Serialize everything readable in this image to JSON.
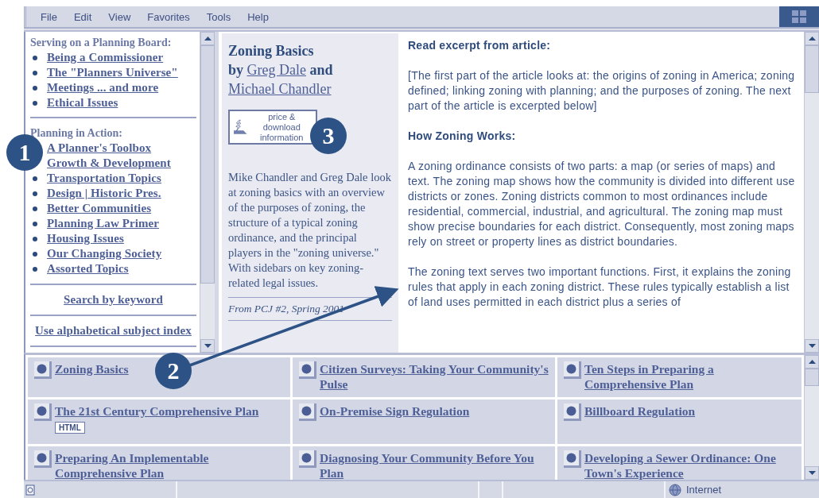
{
  "menu_bar": {
    "items": [
      "File",
      "Edit",
      "View",
      "Favorites",
      "Tools",
      "Help"
    ]
  },
  "nav": {
    "sections": [
      {
        "heading": "Serving on a Planning Board:",
        "links": [
          {
            "label": "Being a Commissioner",
            "bullet": true
          },
          {
            "label": "The \"Planners Universe\"",
            "bullet": true
          },
          {
            "label": "Meetings ... and more",
            "bullet": true
          },
          {
            "label": "Ethical Issues",
            "bullet": true
          }
        ]
      },
      {
        "heading": "Planning in Action:",
        "links": [
          {
            "label": "A Planner's Toolbox",
            "bullet": false
          },
          {
            "label": "Growth & Development",
            "bullet": false
          },
          {
            "label": "Transportation Topics",
            "bullet": true
          },
          {
            "label": "Design | Historic Pres.",
            "bullet": true
          },
          {
            "label": "Better Communities",
            "bullet": true
          },
          {
            "label": "Planning Law Primer",
            "bullet": true
          },
          {
            "label": "Housing Issues",
            "bullet": true
          },
          {
            "label": "Our Changing Society",
            "bullet": true
          },
          {
            "label": "Assorted Topics",
            "bullet": true
          }
        ]
      }
    ],
    "footer_links": [
      "Search by keyword",
      "Use alphabetical subject index"
    ]
  },
  "article": {
    "title": "Zoning Basics",
    "byline_prefix": "by",
    "authors": [
      "Greg Dale",
      "Michael Chandler"
    ],
    "joiner": "and",
    "button_label": "price & download information",
    "summary": "Mike Chandler and Greg Dale look at zoning basics with an overview of the purposes of zoning, the structure of a typical zoning ordinance, and the principal players in the \"zoning universe.\" With sidebars on key zoning-related legal issues.",
    "source": "From PCJ #2, Spring 2001"
  },
  "excerpt": {
    "heading": "Read excerpt from article:",
    "intro": "[The first part of the article looks at: the origins of zoning in America; zoning defined; linking zoning with planning; and the purposes of zoning. The next part of the article is excerpted below]",
    "subheading": "How Zoning Works:",
    "paragraphs": [
      "A zoning ordinance consists of two parts: a map (or series of maps) and text. The zoning map shows how the community is divided into different use districts or zones. Zoning districts common to most ordinances include residential, commercial, industrial, and agricultural. The zoning map must show precise boundaries for each district. Consequently, most zoning maps rely on street or property lines as district boundaries.",
      "The zoning text serves two important functions. First, it explains the zoning rules that apply in each zoning district. These rules typically establish a list of land uses permitted in each district plus a series of"
    ]
  },
  "resources": {
    "rows": [
      [
        {
          "label": "Zoning Basics"
        },
        {
          "label": "Citizen Surveys: Taking Your Community's Pulse"
        },
        {
          "label": "Ten Steps in Preparing a Comprehensive Plan"
        }
      ],
      [
        {
          "label": "The 21st Century Comprehensive Plan",
          "badge": "HTML"
        },
        {
          "label": "On-Premise Sign Regulation"
        },
        {
          "label": "Billboard Regulation"
        }
      ],
      [
        {
          "label": "Preparing An Implementable Comprehensive Plan"
        },
        {
          "label": "Diagnosing Your Community Before You Plan"
        },
        {
          "label": "Developing a Sewer Ordinance: One Town's Experience"
        }
      ]
    ]
  },
  "status_bar": {
    "zone": "Internet"
  },
  "callouts": [
    {
      "number": "1"
    },
    {
      "number": "2"
    },
    {
      "number": "3"
    }
  ]
}
